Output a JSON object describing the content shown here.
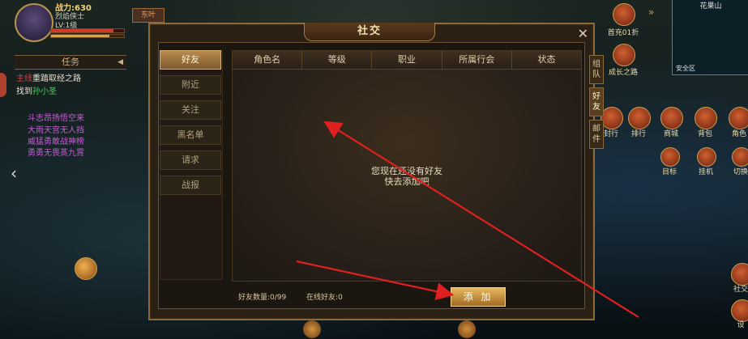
{
  "player": {
    "power": "战力:630",
    "name": "烈焰侠士",
    "level": "LV:1级",
    "hp_fraction": 0.85,
    "mp_fraction": 0.8
  },
  "topleft_button": "东叶",
  "quest": {
    "title": "任务",
    "line1_prefix": "主线",
    "line1_text": "重踏取经之路",
    "line2_prefix": "找到",
    "line2_target": "孙小圣",
    "purple_lines": [
      "斗志昂扬悟空来",
      "大雨天宫无人挡",
      "威猛勇敢战神榜",
      "勇勇无畏蒸九霄"
    ]
  },
  "right_menu": {
    "top": [
      {
        "label": "首充01折",
        "icon": "gift-icon"
      },
      {
        "label": "成长之路",
        "icon": "path-icon"
      }
    ],
    "row": [
      {
        "label": "封行",
        "icon": "seal-icon"
      },
      {
        "label": "排行",
        "icon": "ranking-icon"
      },
      {
        "label": "商城",
        "icon": "shop-icon"
      },
      {
        "label": "背包",
        "icon": "bag-icon"
      },
      {
        "label": "角色",
        "icon": "character-icon"
      }
    ],
    "row2": [
      {
        "label": "目标",
        "icon": "target-icon"
      },
      {
        "label": "挂机",
        "icon": "auto-icon"
      },
      {
        "label": "切换",
        "icon": "switch-icon"
      }
    ],
    "bottom": [
      {
        "label": "社交",
        "icon": "social-icon"
      },
      {
        "label": "设",
        "icon": "settings-icon"
      }
    ]
  },
  "minimap": {
    "title": "花果山",
    "zone": "安全区"
  },
  "dialog": {
    "title": "社交",
    "tabs": [
      "好友",
      "附近",
      "关注",
      "黑名单",
      "请求",
      "战报"
    ],
    "active_tab": 0,
    "columns": [
      "角色名",
      "等级",
      "职业",
      "所属行会",
      "状态"
    ],
    "empty_line1": "您现在还没有好友",
    "empty_line2": "快去添加吧",
    "friend_count": "好友数量:0/99",
    "online_count": "在线好友:0",
    "add_button": "添 加",
    "side_tabs": [
      {
        "line1": "组",
        "line2": "队"
      },
      {
        "line1": "好",
        "line2": "友"
      },
      {
        "line1": "邮",
        "line2": "件"
      }
    ],
    "active_side_tab": 1
  },
  "colors": {
    "arrow": "#e02020",
    "accent": "#b78a4e",
    "quest_red": "#e04040",
    "quest_green": "#4ad060",
    "quest_purple": "#c060d0"
  }
}
